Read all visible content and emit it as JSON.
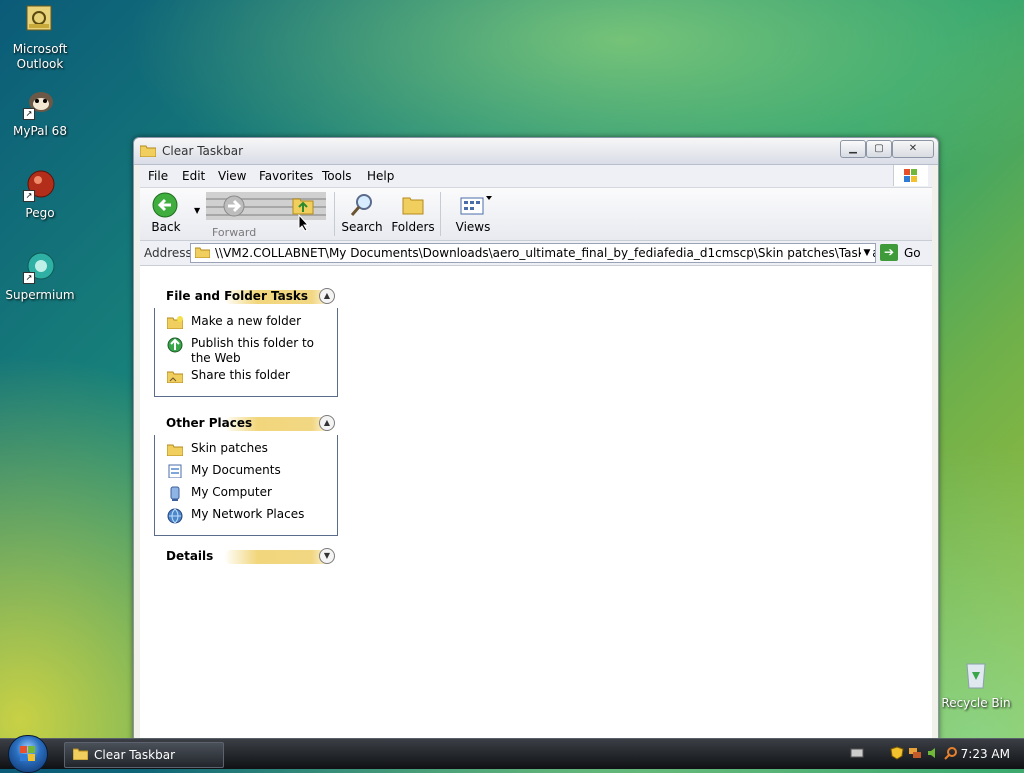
{
  "desktop": {
    "icons": [
      {
        "label": "Microsoft Outlook",
        "icon": "outlook-icon"
      },
      {
        "label": "MyPal 68",
        "icon": "mypal-icon"
      },
      {
        "label": "Pego",
        "icon": "pego-icon"
      },
      {
        "label": "Supermium",
        "icon": "supermium-icon"
      },
      {
        "label": "Recycle Bin",
        "icon": "recycle-bin-icon"
      }
    ]
  },
  "window": {
    "title": "Clear Taskbar",
    "menu": [
      "File",
      "Edit",
      "View",
      "Favorites",
      "Tools",
      "Help"
    ],
    "toolbar": {
      "back": "Back",
      "forward": "Forward",
      "search": "Search",
      "folders": "Folders",
      "views": "Views"
    },
    "address": {
      "label": "Address",
      "value": "\\\\VM2.COLLABNET\\My Documents\\Downloads\\aero_ultimate_final_by_fediafedia_d1cmscp\\Skin patches\\Taskbar Patches",
      "go": "Go"
    },
    "task_panes": {
      "file_folder_tasks": {
        "title": "File and Folder Tasks",
        "items": [
          "Make a new folder",
          "Publish this folder to the Web",
          "Share this folder"
        ]
      },
      "other_places": {
        "title": "Other Places",
        "items": [
          "Skin patches",
          "My Documents",
          "My Computer",
          "My Network Places"
        ]
      },
      "details": {
        "title": "Details"
      }
    }
  },
  "taskbar": {
    "active_task": "Clear Taskbar",
    "clock": "7:23 AM"
  },
  "colors": {
    "accent_blue": "#2a6fc0",
    "pane_border": "#5a6b8c",
    "go_green": "#3f9b3a"
  }
}
